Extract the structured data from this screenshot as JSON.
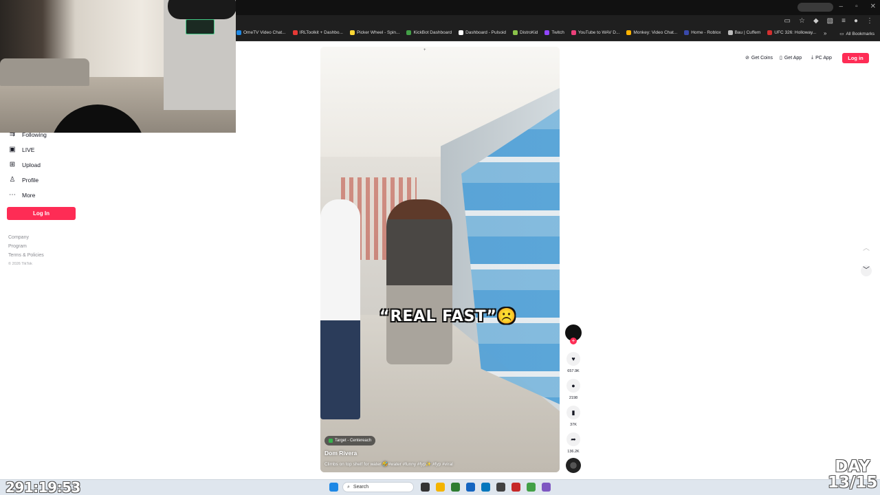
{
  "browser": {
    "bookmarks": [
      {
        "label": "OmeTV Video Chat...",
        "color": "#1e88e5"
      },
      {
        "label": "IRLToolkit + Dashbo...",
        "color": "#e53935"
      },
      {
        "label": "Picker Wheel - Spin...",
        "color": "#fdd835"
      },
      {
        "label": "KickBot Dashboard",
        "color": "#43a047"
      },
      {
        "label": "Dashboard - Pulsoid",
        "color": "#ffffff"
      },
      {
        "label": "DistroKid",
        "color": "#8bc34a"
      },
      {
        "label": "Twitch",
        "color": "#9146ff"
      },
      {
        "label": "YouTube to WAV D...",
        "color": "#ec407a"
      },
      {
        "label": "Monkey: Video Chat...",
        "color": "#ffb300"
      },
      {
        "label": "Home - Roblox",
        "color": "#3949ab"
      },
      {
        "label": "Bau | Cuffem",
        "color": "#bdbdbd"
      },
      {
        "label": "UFC 326: Holloway...",
        "color": "#d32f2f"
      }
    ],
    "bookmarks_overflow": "»",
    "all_bookmarks": "All Bookmarks"
  },
  "sidebar": {
    "items": [
      {
        "label": "Following",
        "icon": "following-icon",
        "glyph": "⇉"
      },
      {
        "label": "LIVE",
        "icon": "live-icon",
        "glyph": "▣"
      },
      {
        "label": "Upload",
        "icon": "upload-icon",
        "glyph": "⊞"
      },
      {
        "label": "Profile",
        "icon": "profile-icon",
        "glyph": "♙"
      },
      {
        "label": "More",
        "icon": "more-icon",
        "glyph": "⋯"
      }
    ],
    "login_label": "Log In",
    "footer_links": [
      "Company",
      "Program",
      "Terms & Policies"
    ],
    "copyright": "© 2026 TikTok"
  },
  "header": {
    "get_coins": "Get Coins",
    "get_app": "Get App",
    "pc_app": "PC App",
    "login_label": "Log in"
  },
  "video": {
    "caption_overlay": "“REAL FAST”☹️",
    "location": "Target - Centereach",
    "author": "Dom Rivera",
    "description": "Climbs on top shelf for water 🤣#water #funny #fyp✨ #fyp #viral"
  },
  "actions": {
    "likes": "657.9K",
    "comments": "2198",
    "saves": "37K",
    "shares": "136.2K"
  },
  "taskbar": {
    "search_placeholder": "Search"
  },
  "overlay": {
    "timer": "291:19:53",
    "day_label": "DAY",
    "day_count": "13/15"
  },
  "colors": {
    "accent": "#fe2c55",
    "text": "#161823"
  }
}
